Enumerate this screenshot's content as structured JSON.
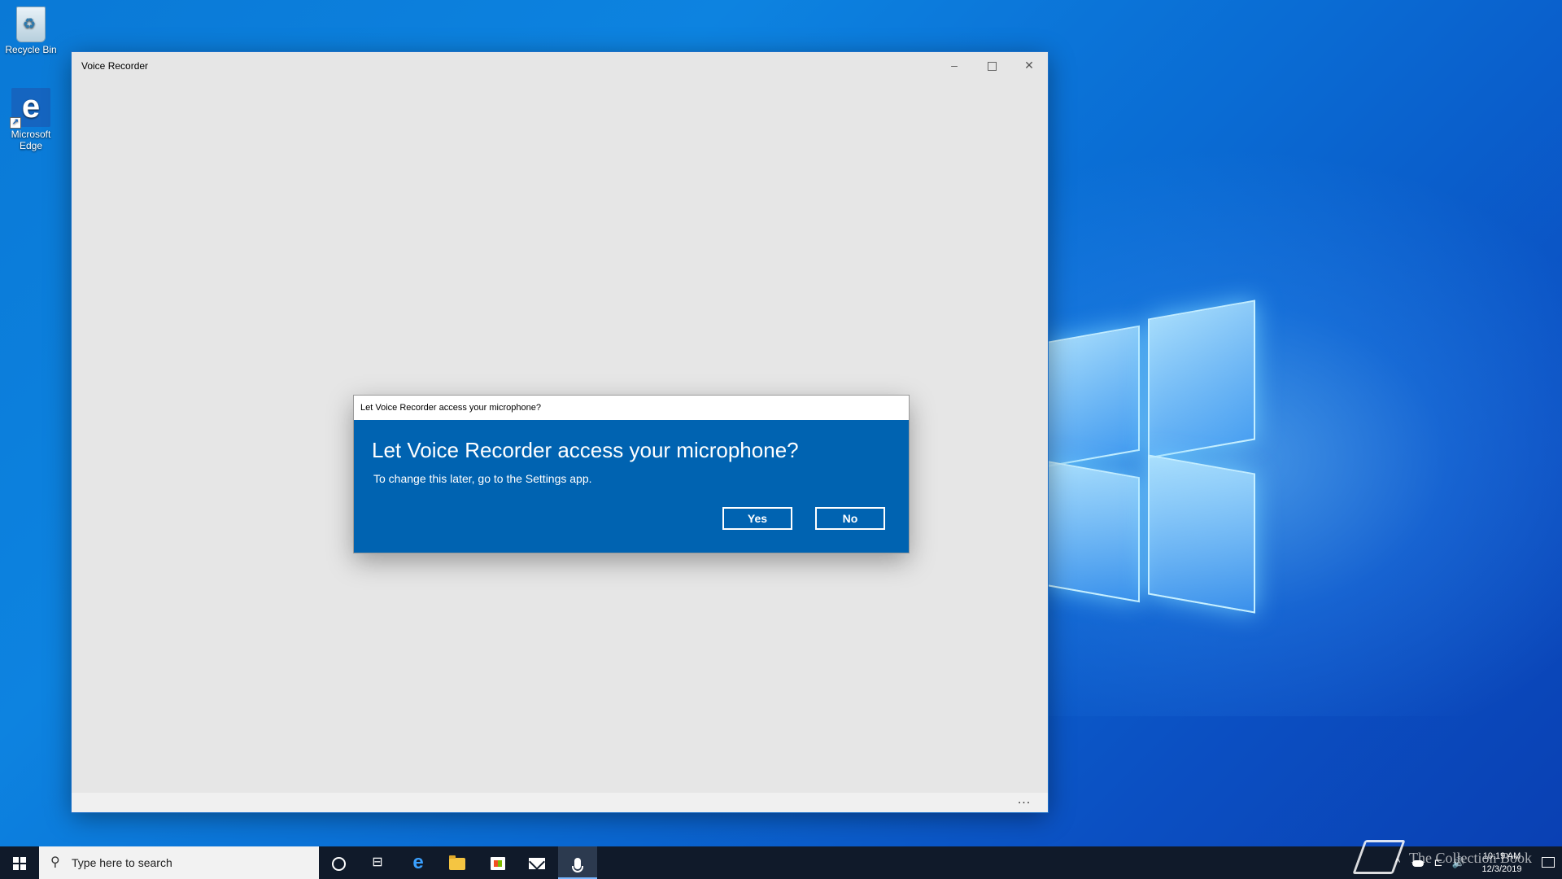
{
  "desktop": {
    "icons": [
      {
        "label": "Recycle Bin",
        "icon": "recycle-bin-icon"
      },
      {
        "label": "Microsoft Edge",
        "icon": "edge-icon"
      }
    ]
  },
  "window": {
    "title": "Voice Recorder",
    "minimize_glyph": "–",
    "close_glyph": "✕",
    "more_label": "..."
  },
  "dialog": {
    "title": "Let Voice Recorder access your microphone?",
    "heading": "Let Voice Recorder access your microphone?",
    "message": "To change this later, go to the Settings app.",
    "yes_label": "Yes",
    "no_label": "No",
    "accent_color": "#0063b1"
  },
  "taskbar": {
    "search_placeholder": "Type here to search",
    "search_glyph": "⚲",
    "taskview_glyph": "⊟",
    "edge_glyph": "e",
    "tray_chevron": "^",
    "network_glyph": "⊏",
    "volume_glyph": "🔊",
    "time": "10:19 AM",
    "date": "12/3/2019",
    "pinned": [
      "start",
      "search",
      "cortana",
      "task-view",
      "edge",
      "file-explorer",
      "store",
      "mail",
      "voice-recorder"
    ],
    "active_app": "voice-recorder"
  },
  "watermark": {
    "text": "The Collection Book"
  }
}
